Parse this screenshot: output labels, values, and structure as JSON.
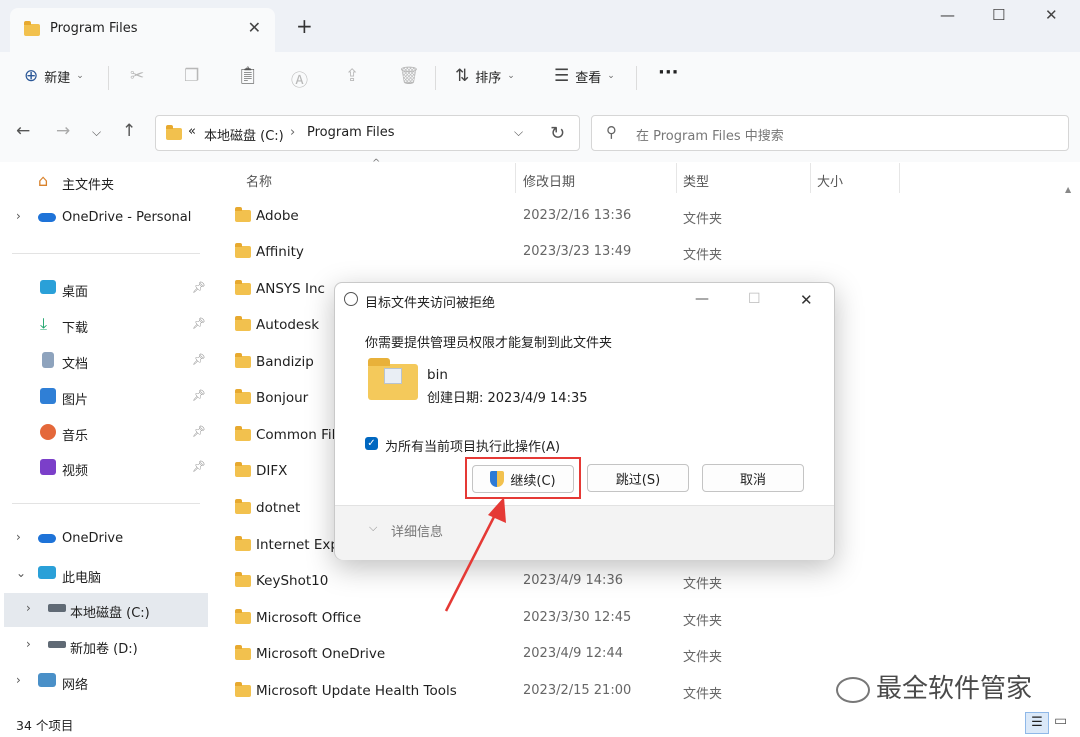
{
  "window": {
    "tab_title": "Program Files",
    "new_tab": "+",
    "minimize": "—",
    "maximize": "☐",
    "close": "✕"
  },
  "toolbar": {
    "new_label": "新建",
    "sort_label": "排序",
    "view_label": "查看",
    "more": "···"
  },
  "address": {
    "overflow": "«",
    "crumbs": [
      "本地磁盘 (C:)",
      "Program Files"
    ],
    "search_placeholder": "在 Program Files 中搜索"
  },
  "sidebar": {
    "items": [
      {
        "label": "主文件夹",
        "icon": "home-icon"
      },
      {
        "label": "OneDrive - Personal",
        "icon": "cloud-icon"
      },
      {
        "label": "桌面",
        "icon": "desktop-icon"
      },
      {
        "label": "下载",
        "icon": "download-icon"
      },
      {
        "label": "文档",
        "icon": "document-icon"
      },
      {
        "label": "图片",
        "icon": "picture-icon"
      },
      {
        "label": "音乐",
        "icon": "music-icon"
      },
      {
        "label": "视频",
        "icon": "video-icon"
      },
      {
        "label": "OneDrive",
        "icon": "cloud-icon"
      },
      {
        "label": "此电脑",
        "icon": "computer-icon"
      },
      {
        "label": "本地磁盘 (C:)",
        "icon": "drive-icon"
      },
      {
        "label": "新加卷 (D:)",
        "icon": "drive-icon"
      },
      {
        "label": "网络",
        "icon": "network-icon"
      }
    ]
  },
  "columns": {
    "name": "名称",
    "date": "修改日期",
    "type": "类型",
    "size": "大小"
  },
  "files": [
    {
      "name": "Adobe",
      "date": "2023/2/16 13:36",
      "type": "文件夹"
    },
    {
      "name": "Affinity",
      "date": "2023/3/23 13:49",
      "type": "文件夹"
    },
    {
      "name": "ANSYS Inc",
      "date": "",
      "type": ""
    },
    {
      "name": "Autodesk",
      "date": "",
      "type": ""
    },
    {
      "name": "Bandizip",
      "date": "",
      "type": ""
    },
    {
      "name": "Bonjour",
      "date": "",
      "type": ""
    },
    {
      "name": "Common Fil",
      "date": "",
      "type": ""
    },
    {
      "name": "DIFX",
      "date": "",
      "type": ""
    },
    {
      "name": "dotnet",
      "date": "",
      "type": ""
    },
    {
      "name": "Internet Exp",
      "date": "",
      "type": ""
    },
    {
      "name": "KeyShot10",
      "date": "2023/4/9 14:36",
      "type": "文件夹"
    },
    {
      "name": "Microsoft Office",
      "date": "2023/3/30 12:45",
      "type": "文件夹"
    },
    {
      "name": "Microsoft OneDrive",
      "date": "2023/4/9 12:44",
      "type": "文件夹"
    },
    {
      "name": "Microsoft Update Health Tools",
      "date": "2023/2/15 21:00",
      "type": "文件夹"
    }
  ],
  "status": {
    "count": "34 个项目"
  },
  "dialog": {
    "title": "目标文件夹访问被拒绝",
    "message": "你需要提供管理员权限才能复制到此文件夹",
    "folder_name": "bin",
    "created": "创建日期: 2023/4/9 14:35",
    "checkbox_label": "为所有当前项目执行此操作(A)",
    "continue_label": "继续(C)",
    "skip_label": "跳过(S)",
    "cancel_label": "取消",
    "details_label": "详细信息"
  },
  "watermark": "最全软件管家",
  "colors": {
    "accent": "#0067c0",
    "highlight": "#e53935",
    "folder": "#f2c14e"
  }
}
